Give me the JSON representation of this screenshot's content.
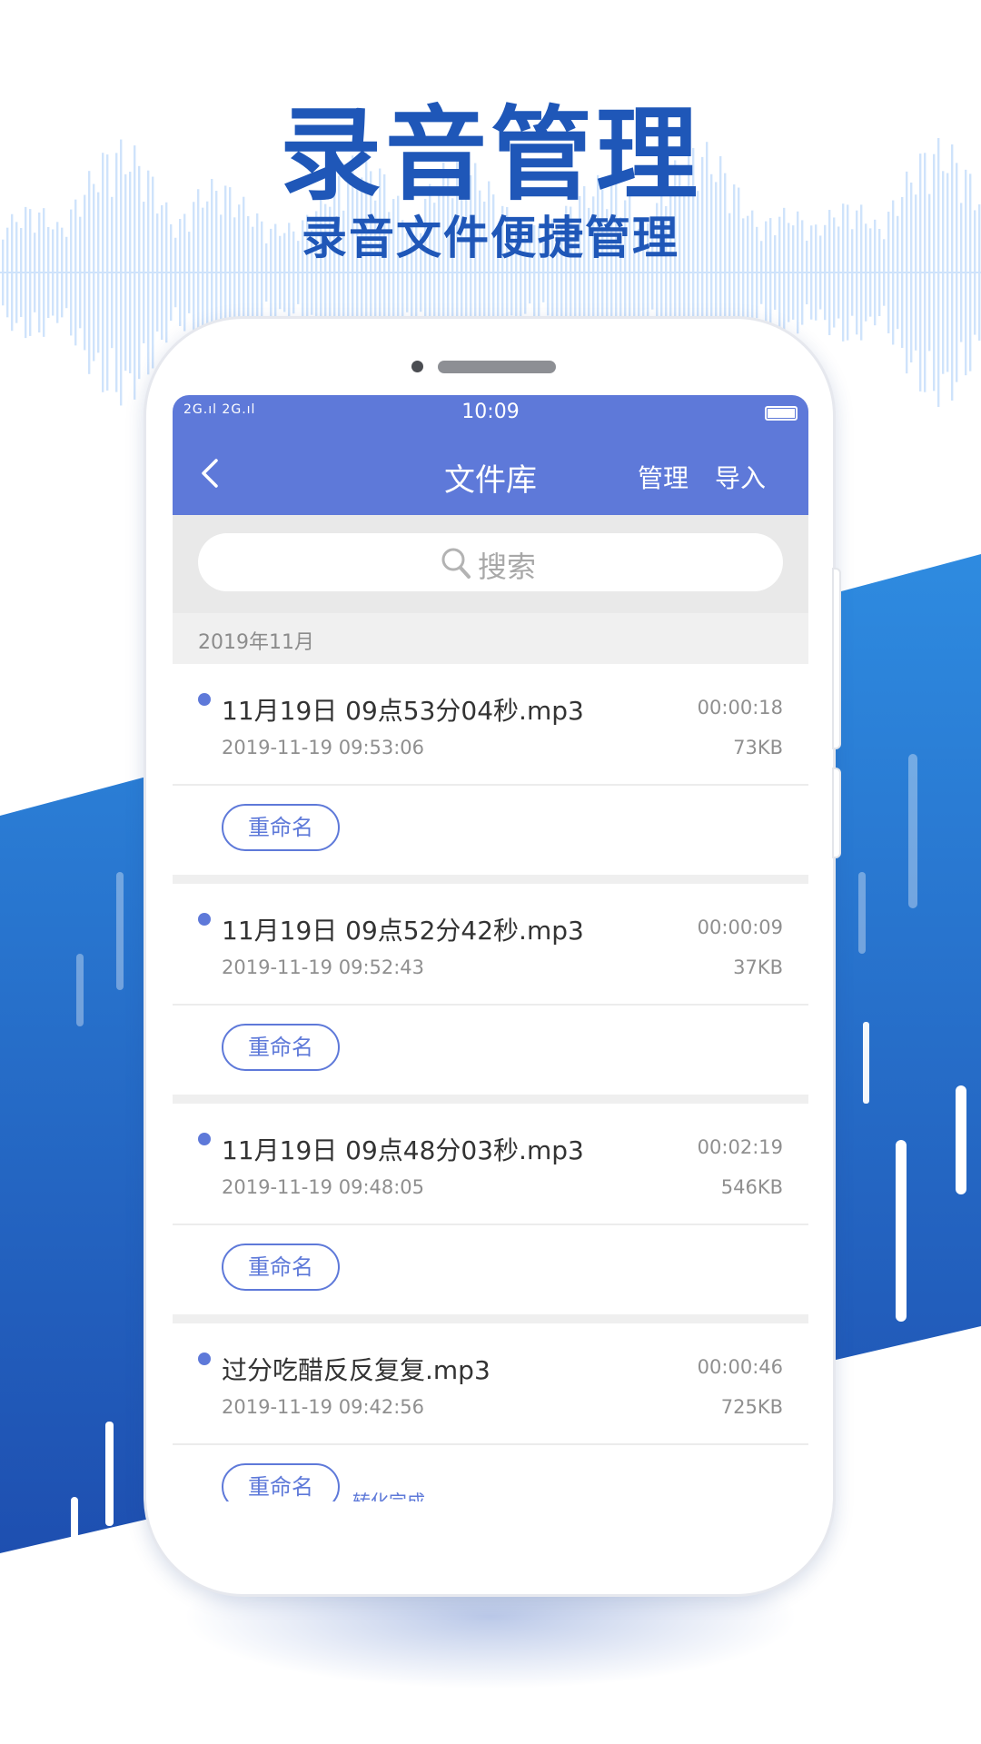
{
  "colors": {
    "brand_blue": "#1f57b8",
    "band_blue_top": "#2e8be0",
    "band_blue_bottom": "#1e4fb0",
    "nav_blue": "#5e79d9",
    "wave_blue": "#cfe3fb"
  },
  "headline": {
    "title": "录音管理",
    "subtitle": "录音文件便捷管理"
  },
  "status_bar": {
    "signal": "2G.ıl 2G.ıl",
    "time": "10:09"
  },
  "navbar": {
    "back_icon": "chevron-left-icon",
    "title": "文件库",
    "manage_label": "管理",
    "import_label": "导入"
  },
  "search": {
    "icon": "search-icon",
    "placeholder": "搜索"
  },
  "month_header": "2019年11月",
  "records": [
    {
      "name": "11月19日 09点53分04秒.mp3",
      "timestamp": "2019-11-19 09:53:06",
      "duration": "00:00:18",
      "size": "73KB",
      "rename_label": "重命名",
      "status": ""
    },
    {
      "name": "11月19日 09点52分42秒.mp3",
      "timestamp": "2019-11-19 09:52:43",
      "duration": "00:00:09",
      "size": "37KB",
      "rename_label": "重命名",
      "status": ""
    },
    {
      "name": "11月19日 09点48分03秒.mp3",
      "timestamp": "2019-11-19 09:48:05",
      "duration": "00:02:19",
      "size": "546KB",
      "rename_label": "重命名",
      "status": ""
    },
    {
      "name": "过分吃醋反反复复.mp3",
      "timestamp": "2019-11-19 09:42:56",
      "duration": "00:00:46",
      "size": "725KB",
      "rename_label": "重命名",
      "status": "转化完成"
    }
  ]
}
